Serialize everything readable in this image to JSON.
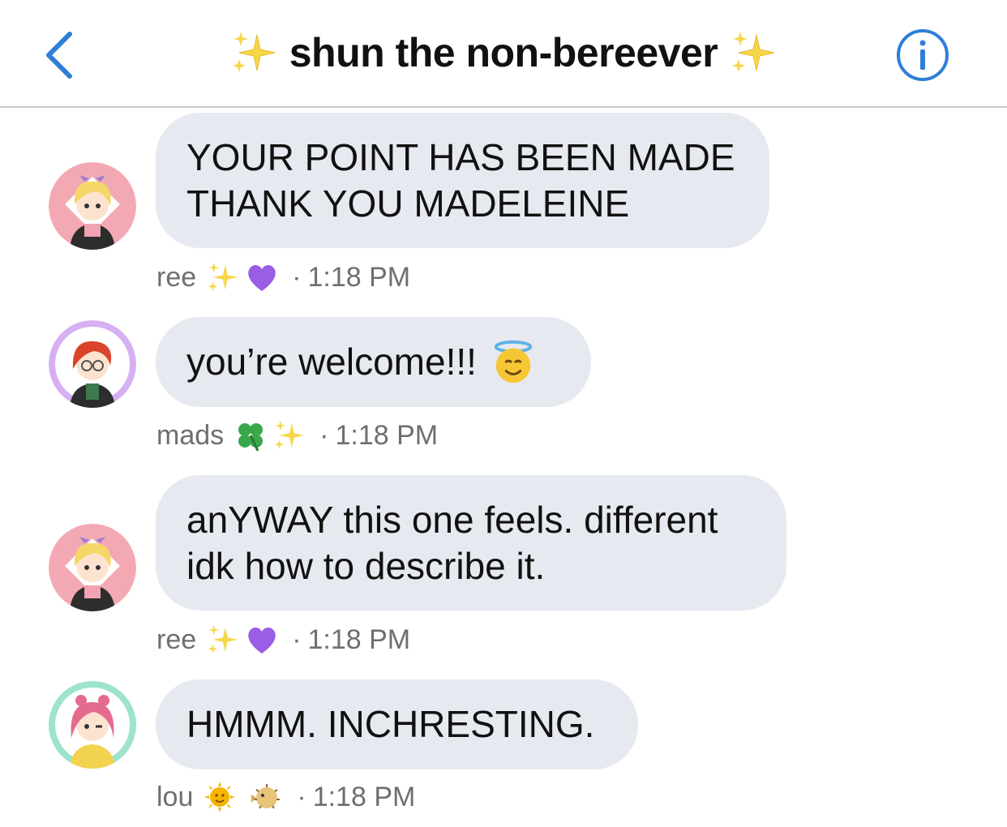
{
  "header": {
    "title": "shun the non-bereever",
    "back_icon": "chevron-left-icon",
    "info_icon": "info-icon",
    "accent": "#2f7ed8"
  },
  "messages": [
    {
      "lines": [
        "YOUR POINT HAS BEEN MADE",
        "THANK YOU MADELEINE"
      ],
      "sender": "ree",
      "emojis": [
        "sparkles-icon",
        "purple-heart-icon"
      ],
      "time": "1:18 PM",
      "avatar_ring": "#f3a9b3"
    },
    {
      "lines": [
        "you’re welcome!!!"
      ],
      "emoji_inline": "smiling-face-with-halo-icon",
      "sender": "mads",
      "emojis": [
        "four-leaf-clover-icon",
        "sparkles-icon"
      ],
      "time": "1:18 PM",
      "avatar_ring": "#d6b0f2"
    },
    {
      "lines": [
        "anYWAY this one feels. different",
        "idk how to describe it."
      ],
      "sender": "ree",
      "emojis": [
        "sparkles-icon",
        "purple-heart-icon"
      ],
      "time": "1:18 PM",
      "avatar_ring": "#f3a9b3"
    },
    {
      "lines": [
        "HMMM. INCHRESTING."
      ],
      "sender": "lou",
      "emojis": [
        "sun-with-face-icon",
        "blowfish-icon"
      ],
      "time": "1:18 PM",
      "avatar_ring": "#9ee3cc"
    }
  ],
  "separator": "·"
}
